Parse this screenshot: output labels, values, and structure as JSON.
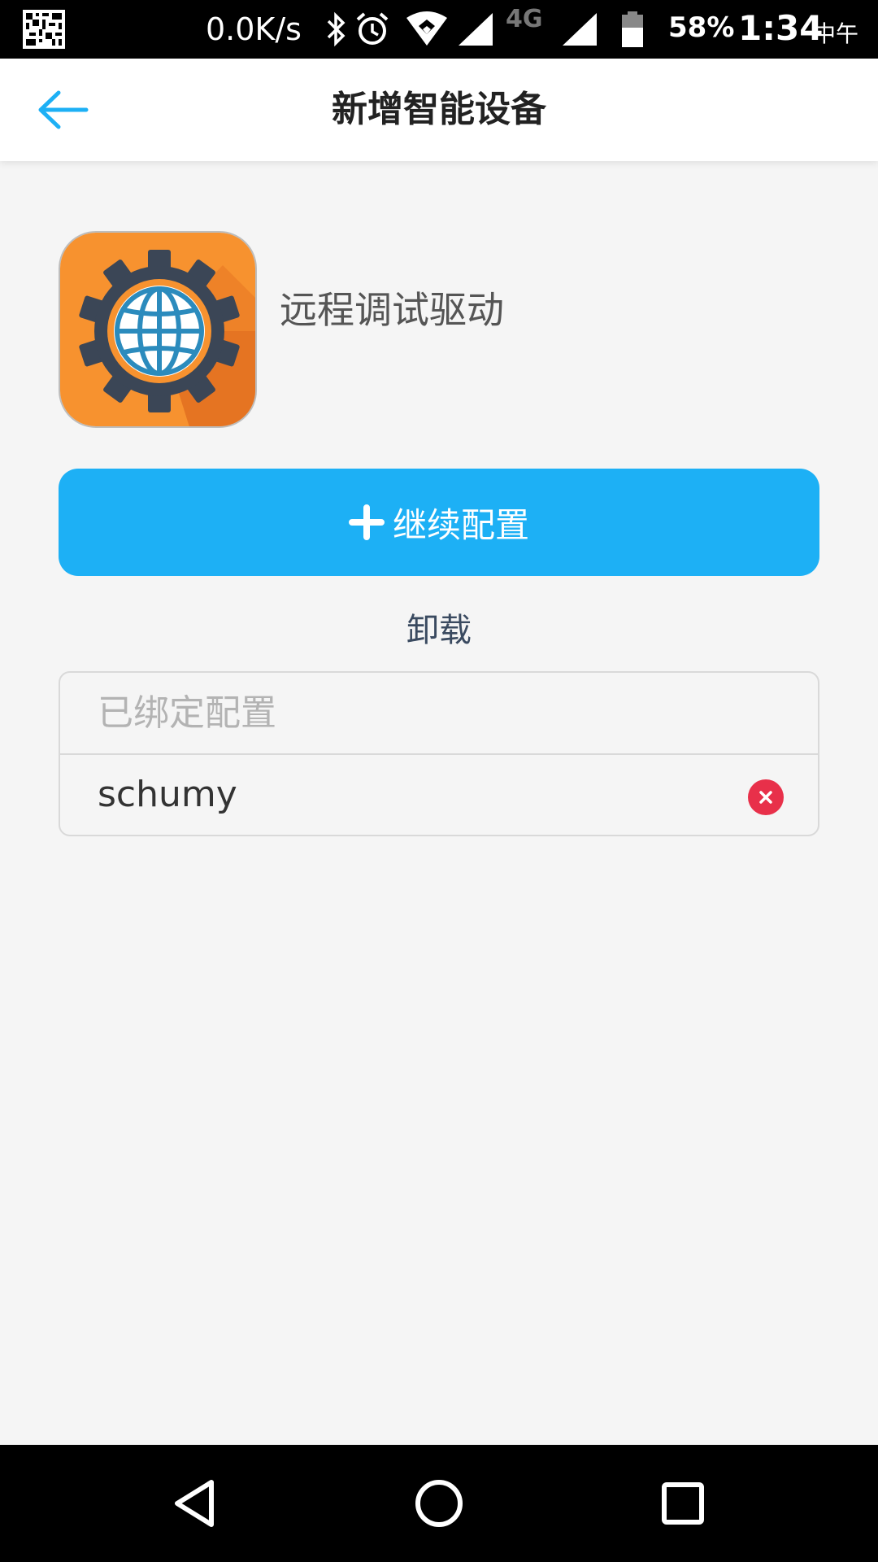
{
  "status_bar": {
    "net_speed": "0.0K/s",
    "network": "4G",
    "battery": "58%",
    "time": "1:34",
    "ampm": "中午",
    "icons": [
      "qr-code-icon",
      "bluetooth-icon",
      "alarm-icon",
      "wifi-icon",
      "signal-icon",
      "signal-icon",
      "battery-icon"
    ]
  },
  "app_bar": {
    "title": "新增智能设备",
    "back_icon": "arrow-left-icon",
    "accent_color": "#1db0f5"
  },
  "device": {
    "icon": "globe-gear-icon",
    "name": "远程调试驱动"
  },
  "actions": {
    "continue_label": "继续配置",
    "uninstall_label": "卸载",
    "button_color": "#1db0f5"
  },
  "bound_configs": {
    "header": "已绑定配置",
    "items": [
      {
        "name": "schumy"
      }
    ],
    "remove_color": "#e8304a"
  },
  "nav_bar": {
    "icons": [
      "back-triangle-icon",
      "home-circle-icon",
      "recents-square-icon"
    ]
  }
}
